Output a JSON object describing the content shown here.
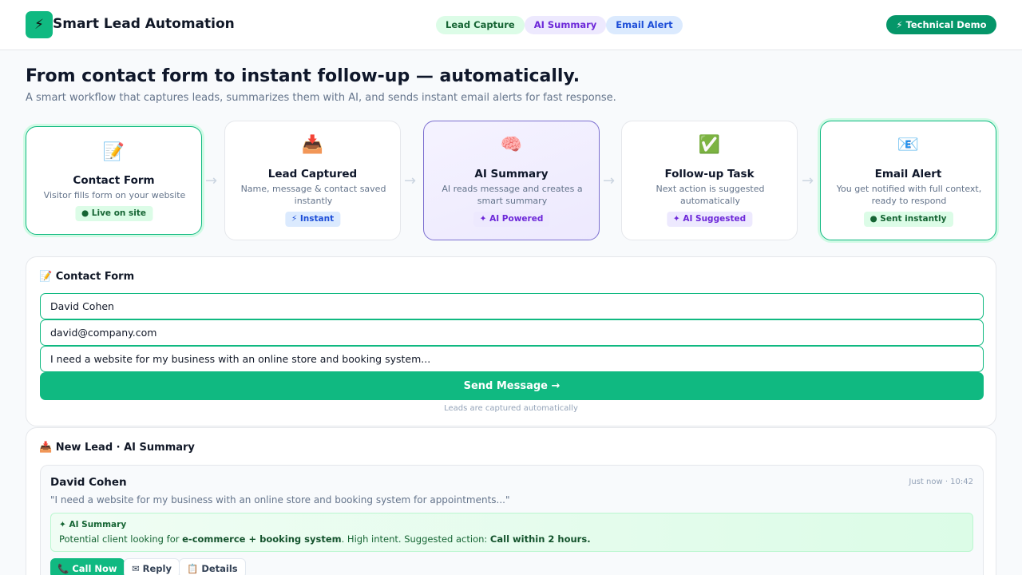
{
  "header": {
    "logo_icon": "⚡",
    "brand": "Smart Lead Automation",
    "pills": [
      "Lead Capture",
      "AI Summary",
      "Email Alert"
    ],
    "demo_button": "⚡ Technical Demo"
  },
  "hero": {
    "title": "From contact form to instant follow-up — automatically.",
    "subtitle": "A smart workflow that captures leads, summarizes them with AI, and sends instant email alerts for fast response."
  },
  "steps": [
    {
      "icon": "📝",
      "icon_name": "form-icon",
      "title": "Contact Form",
      "desc": "Visitor fills form on your website",
      "badge": "● Live on site"
    },
    {
      "icon": "📥",
      "icon_name": "inbox-icon",
      "title": "Lead Captured",
      "desc": "Name, message & contact saved instantly",
      "badge": "⚡ Instant"
    },
    {
      "icon": "🧠",
      "icon_name": "brain-icon",
      "title": "AI Summary",
      "desc": "AI reads message and creates a smart summary",
      "badge": "✦ AI Powered"
    },
    {
      "icon": "✅",
      "icon_name": "check-icon",
      "title": "Follow-up Task",
      "desc": "Next action is suggested automatically",
      "badge": "✦ AI Suggested"
    },
    {
      "icon": "📧",
      "icon_name": "email-icon",
      "title": "Email Alert",
      "desc": "You get notified with full context, ready to respond",
      "badge": "● Sent instantly"
    }
  ],
  "arrow": "→",
  "contact_form": {
    "title": "📝 Contact Form",
    "name_value": "David Cohen",
    "email_value": "david@company.com",
    "message_value": "I need a website for my business with an online store and booking system...",
    "send_label": "Send Message →",
    "note": "Leads are captured automatically"
  },
  "new_lead": {
    "title": "📥 New Lead · AI Summary",
    "name": "David Cohen",
    "time": "Just now · 10:42",
    "message": "\"I need a website for my business with an online store and booking system for appointments...\"",
    "ai_label": "✦ AI Summary",
    "ai_text_1": "Potential client looking for ",
    "ai_text_bold_1": "e-commerce + booking system",
    "ai_text_2": ". High intent. Suggested action: ",
    "ai_text_bold_2": "Call within 2 hours.",
    "actions": {
      "call": "📞 Call Now",
      "reply": "✉ Reply",
      "details": "📋 Details"
    }
  }
}
